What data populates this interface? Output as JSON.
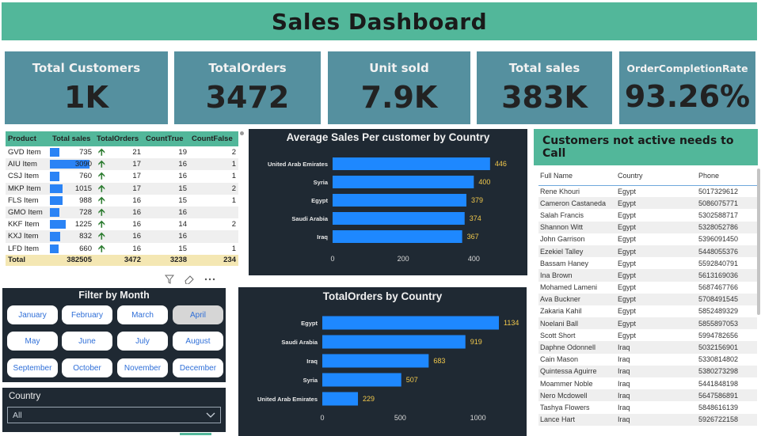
{
  "title": "Sales Dashboard",
  "kpis": [
    {
      "label": "Total Customers",
      "value": "1K"
    },
    {
      "label": "TotalOrders",
      "value": "3472"
    },
    {
      "label": "Unit sold",
      "value": "7.9K"
    },
    {
      "label": "Total sales",
      "value": "383K"
    },
    {
      "label": "OrderCompletionRate",
      "value": "93.26%"
    }
  ],
  "product_table": {
    "headers": [
      "Product",
      "Total sales",
      "TotalOrders",
      "CountTrue",
      "CountFalse"
    ],
    "rows": [
      {
        "product": "GVD Item",
        "sales": "735",
        "orders": "21",
        "ctrue": "19",
        "cfalse": "2",
        "sales_num": 735
      },
      {
        "product": "AIU Item",
        "sales": "3090",
        "orders": "17",
        "ctrue": "16",
        "cfalse": "1",
        "sales_num": 3090
      },
      {
        "product": "CSJ Item",
        "sales": "760",
        "orders": "17",
        "ctrue": "16",
        "cfalse": "1",
        "sales_num": 760
      },
      {
        "product": "MKP Item",
        "sales": "1015",
        "orders": "17",
        "ctrue": "15",
        "cfalse": "2",
        "sales_num": 1015
      },
      {
        "product": "FLS Item",
        "sales": "988",
        "orders": "16",
        "ctrue": "15",
        "cfalse": "1",
        "sales_num": 988
      },
      {
        "product": "GMO Item",
        "sales": "728",
        "orders": "16",
        "ctrue": "16",
        "cfalse": "",
        "sales_num": 728
      },
      {
        "product": "KKF Item",
        "sales": "1225",
        "orders": "16",
        "ctrue": "14",
        "cfalse": "2",
        "sales_num": 1225
      },
      {
        "product": "KXJ Item",
        "sales": "832",
        "orders": "16",
        "ctrue": "16",
        "cfalse": "",
        "sales_num": 832
      },
      {
        "product": "LFD Item",
        "sales": "660",
        "orders": "16",
        "ctrue": "15",
        "cfalse": "1",
        "sales_num": 660
      }
    ],
    "total": {
      "label": "Total",
      "sales": "382505",
      "orders": "3472",
      "ctrue": "3238",
      "cfalse": "234"
    }
  },
  "month_filter": {
    "title": "Filter by Month",
    "months": [
      "January",
      "February",
      "March",
      "April",
      "May",
      "June",
      "July",
      "August",
      "September",
      "October",
      "November",
      "December"
    ],
    "selected": "April"
  },
  "country_filter": {
    "label": "Country",
    "value": "All"
  },
  "customers": {
    "title": "Customers not active needs to Call",
    "headers": [
      "Full Name",
      "Country",
      "Phone"
    ],
    "rows": [
      [
        "Rene Khouri",
        "Egypt",
        "5017329612"
      ],
      [
        "Cameron Castaneda",
        "Egypt",
        "5086075771"
      ],
      [
        "Salah Francis",
        "Egypt",
        "5302588717"
      ],
      [
        "Shannon Witt",
        "Egypt",
        "5328052786"
      ],
      [
        "John Garrison",
        "Egypt",
        "5396091450"
      ],
      [
        "Ezekiel Talley",
        "Egypt",
        "5448055376"
      ],
      [
        "Bassam Haney",
        "Egypt",
        "5592840791"
      ],
      [
        "Ina Brown",
        "Egypt",
        "5613169036"
      ],
      [
        "Mohamed Lameni",
        "Egypt",
        "5687467766"
      ],
      [
        "Ava Buckner",
        "Egypt",
        "5708491545"
      ],
      [
        "Zakaria Kahil",
        "Egypt",
        "5852489329"
      ],
      [
        "Noelani Ball",
        "Egypt",
        "5855897053"
      ],
      [
        "Scott Short",
        "Egypt",
        "5994782656"
      ],
      [
        "Daphne Odonnell",
        "Iraq",
        "5032156901"
      ],
      [
        "Cain Mason",
        "Iraq",
        "5330814802"
      ],
      [
        "Quintessa Aguirre",
        "Iraq",
        "5380273298"
      ],
      [
        "Moammer Noble",
        "Iraq",
        "5441848198"
      ],
      [
        "Nero Mcdowell",
        "Iraq",
        "5647586891"
      ],
      [
        "Tashya Flowers",
        "Iraq",
        "5848616139"
      ],
      [
        "Lance Hart",
        "Iraq",
        "5926722158"
      ]
    ]
  },
  "colors": {
    "accent": "#52b79a",
    "kpi": "#55909f",
    "bar": "#1e88ff",
    "panel": "#1f2933",
    "label": "#f2c94c"
  },
  "chart_data": [
    {
      "type": "bar",
      "orientation": "horizontal",
      "title": "Average Sales Per customer by Country",
      "categories": [
        "United Arab Emirates",
        "Syria",
        "Egypt",
        "Saudi Arabia",
        "Iraq"
      ],
      "values": [
        446,
        400,
        379,
        374,
        367
      ],
      "xticks": [
        0,
        200,
        400
      ],
      "xlim": [
        0,
        480
      ]
    },
    {
      "type": "bar",
      "orientation": "horizontal",
      "title": "TotalOrders by Country",
      "categories": [
        "Egypt",
        "Saudi Arabia",
        "Iraq",
        "Syria",
        "United Arab Emirates"
      ],
      "values": [
        1134,
        919,
        683,
        507,
        229
      ],
      "xticks": [
        0,
        500,
        1000
      ],
      "xlim": [
        0,
        1200
      ]
    }
  ]
}
